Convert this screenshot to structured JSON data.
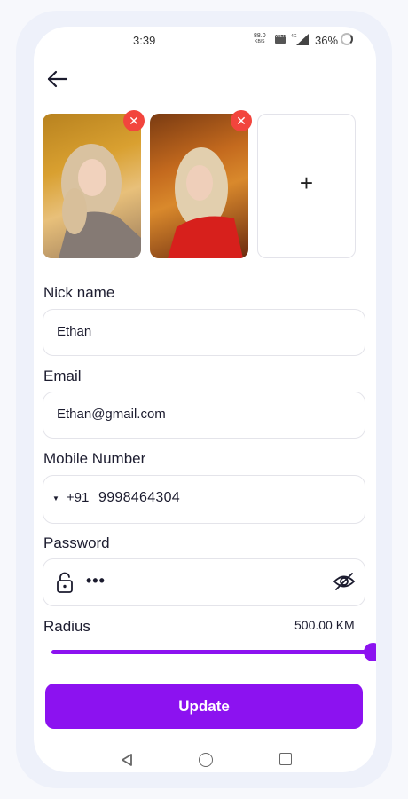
{
  "status_bar": {
    "time": "3:39",
    "net_speed_value": "88.0",
    "net_speed_unit": "KB/S",
    "volte_label": "VoLTE",
    "signal_label": "4G",
    "battery_percent": "36%"
  },
  "photos": {
    "items": [
      {
        "alt": "photo 1"
      },
      {
        "alt": "photo 2"
      }
    ],
    "remove_symbol": "✕",
    "add_symbol": "+"
  },
  "form": {
    "nickname": {
      "label": "Nick name",
      "value": "Ethan"
    },
    "email": {
      "label": "Email",
      "value": "Ethan@gmail.com"
    },
    "mobile": {
      "label": "Mobile Number",
      "country_code": "+91",
      "value": "9998464304"
    },
    "password": {
      "label": "Password",
      "value": "•••"
    },
    "radius": {
      "label": "Radius",
      "value_text": "500.00 KM",
      "fill_fraction": 1.0
    }
  },
  "actions": {
    "update_label": "Update"
  },
  "colors": {
    "accent": "#8c12f0",
    "remove": "#f2453d"
  }
}
